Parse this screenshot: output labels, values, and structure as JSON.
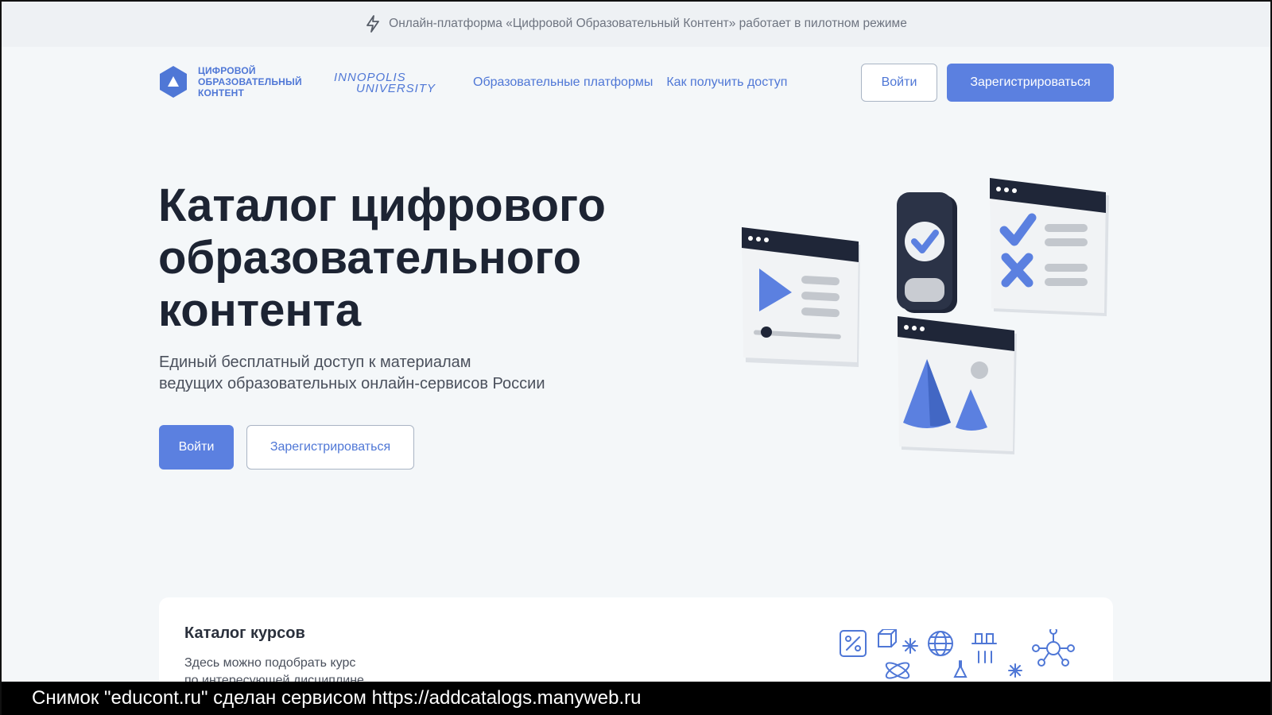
{
  "notice": {
    "text": "Онлайн-платформа «Цифровой Образовательный Контент» работает в пилотном режиме",
    "icon": "lightning-icon"
  },
  "header": {
    "logo": {
      "line1": "ЦИФРОВОЙ",
      "line2": "ОБРАЗОВАТЕЛЬНЫЙ",
      "line3": "КОНТЕНТ"
    },
    "partner": "INNOPOLIS UNIVERSITY",
    "nav": [
      {
        "label": "Образовательные платформы"
      },
      {
        "label": "Как получить доступ"
      }
    ],
    "login_label": "Войти",
    "register_label": "Зарегистрироваться"
  },
  "hero": {
    "title_line1": "Каталог цифрового",
    "title_line2": "образовательного",
    "title_line3": "контента",
    "subtitle_line1": "Единый бесплатный доступ к материалам",
    "subtitle_line2": "ведущих образовательных онлайн-сервисов России",
    "login_label": "Войти",
    "register_label": "Зарегистрироваться"
  },
  "catalog": {
    "title": "Каталог курсов",
    "desc_line1": "Здесь можно подобрать курс",
    "desc_line2": "по интересующей дисциплине"
  },
  "watermark": "Снимок \"educont.ru\" сделан сервисом https://addcatalogs.manyweb.ru",
  "colors": {
    "accent": "#5b80e0",
    "dark": "#1d2433",
    "background": "#f4f7f9"
  }
}
